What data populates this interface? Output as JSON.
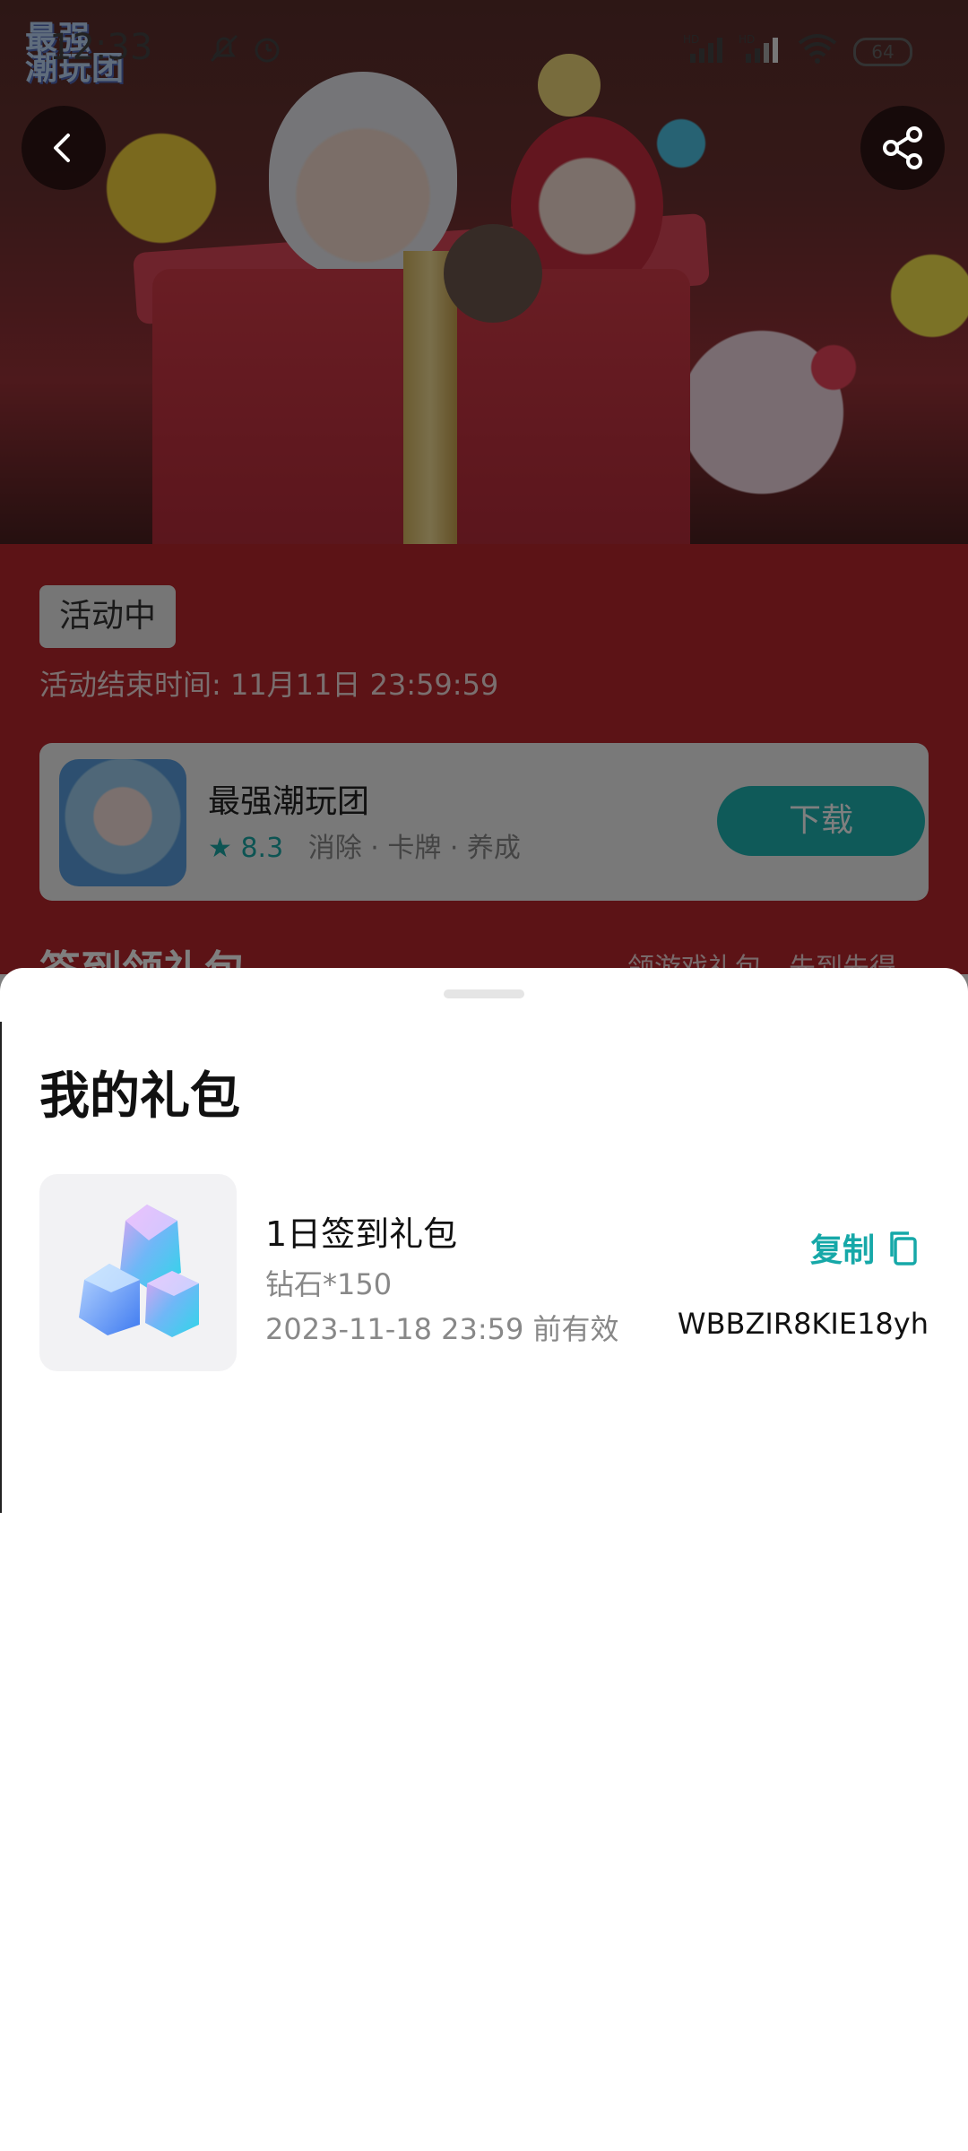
{
  "status_bar": {
    "time": "12:33",
    "battery": "64",
    "icons": [
      "mute-bell-icon",
      "alarm-icon",
      "hd-signal-icon",
      "hd-signal-icon",
      "wifi-icon"
    ]
  },
  "hero": {
    "logo_line1": "最强",
    "logo_line2": "潮玩团"
  },
  "activity": {
    "status_label": "活动中",
    "end_time": "活动结束时间: 11月11日 23:59:59"
  },
  "app": {
    "name": "最强潮玩团",
    "rating": "8.3",
    "tags": "消除 · 卡牌 · 养成",
    "download_label": "下载"
  },
  "section": {
    "title": "签到领礼包",
    "side_text": "领游戏礼包，先到先得"
  },
  "sheet": {
    "title": "我的礼包",
    "gift": {
      "title": "1日签到礼包",
      "desc": "钻石*150",
      "valid": "2023-11-18 23:59 前有效",
      "copy_label": "复制",
      "code": "WBBZIR8KIE18yh"
    }
  },
  "colors": {
    "accent": "#1fb4b3",
    "content_bg": "#b8262c"
  }
}
